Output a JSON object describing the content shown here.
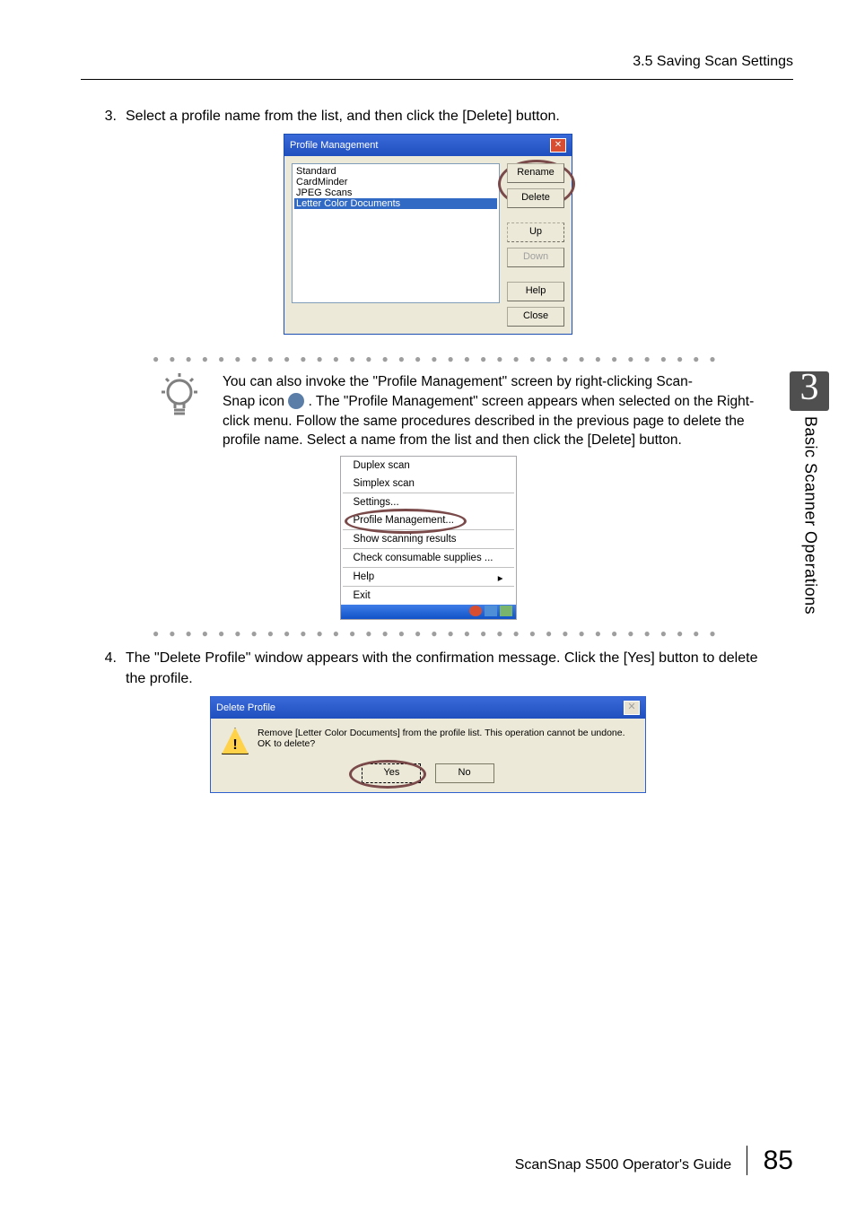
{
  "header": {
    "section": "3.5 Saving Scan Settings"
  },
  "side_tab": {
    "chapter_num": "3",
    "chapter_title": "Basic Scanner Operations"
  },
  "steps": {
    "s3": {
      "num": "3.",
      "text": "Select a profile name from the list, and then click the [Delete] button."
    },
    "s4": {
      "num": "4.",
      "text": "The \"Delete Profile\" window appears with the confirmation message. Click the [Yes] button to delete the profile."
    }
  },
  "pm_dialog": {
    "title": "Profile Management",
    "items": [
      "Standard",
      "CardMinder",
      "JPEG Scans",
      "Letter Color Documents"
    ],
    "buttons": {
      "rename": "Rename",
      "delete": "Delete",
      "up": "Up",
      "down": "Down",
      "help": "Help",
      "close": "Close"
    }
  },
  "tip": {
    "line1": "You can also invoke the \"Profile Management\" screen by right-clicking Scan-",
    "line2a": "Snap icon ",
    "line2b": " . The \"Profile Management\" screen appears when selected on the Right-click menu. Follow the same procedures described in the previous page to delete the profile name. Select a name from the list and then click the [Delete] button."
  },
  "ctx_menu": {
    "duplex": "Duplex scan",
    "simplex": "Simplex scan",
    "settings": "Settings...",
    "pm": "Profile Management...",
    "show": "Show scanning results",
    "check": "Check consumable supplies ...",
    "help": "Help",
    "exit": "Exit"
  },
  "dp_dialog": {
    "title": "Delete Profile",
    "msg": "Remove [Letter Color Documents] from the profile list. This operation cannot be undone. OK to delete?",
    "yes": "Yes",
    "no": "No"
  },
  "footer": {
    "guide": "ScanSnap S500 Operator's Guide",
    "page": "85"
  }
}
